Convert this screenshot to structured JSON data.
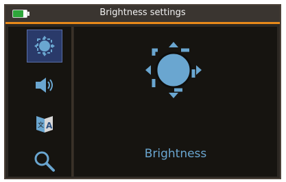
{
  "window": {
    "title": "Brightness settings",
    "battery": {
      "level": 0.75,
      "color": "#2ea63a"
    }
  },
  "sidebar": {
    "items": [
      {
        "icon": "brightness-icon",
        "selected": true
      },
      {
        "icon": "speaker-icon",
        "selected": false
      },
      {
        "icon": "language-icon",
        "selected": false
      },
      {
        "icon": "search-icon",
        "selected": false
      }
    ]
  },
  "main": {
    "label": "Brightness",
    "icon": "brightness-icon"
  },
  "colors": {
    "accent": "#e88a1a",
    "icon": "#6aa6d0",
    "selection": "#2a3a6a"
  }
}
